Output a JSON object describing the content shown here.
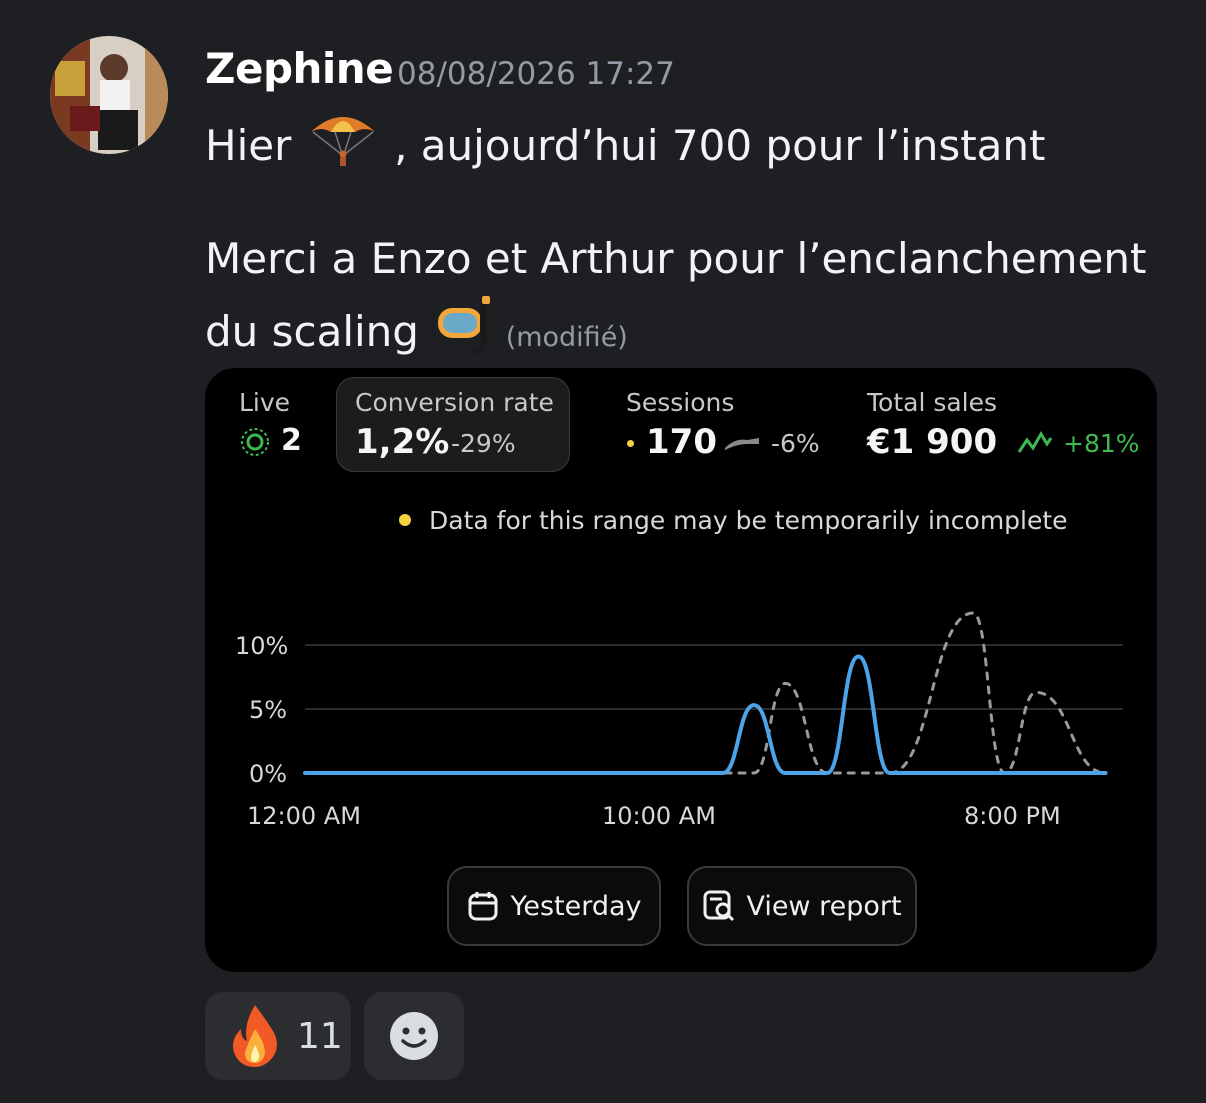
{
  "message": {
    "author": "Zephine",
    "timestamp": "08/08/2026 17:27",
    "line1_before": "Hier",
    "line1_after": ", aujourd’hui 700 pour l’instant",
    "line2": "Merci a Enzo et Arthur pour l’enclanchement",
    "line3": "du scaling",
    "edited_label": "(modifié)",
    "icons": [
      "parachute-emoji",
      "diving-mask-emoji"
    ]
  },
  "embed": {
    "live": {
      "label": "Live",
      "value": "2"
    },
    "conversion": {
      "label": "Conversion rate",
      "value": "1,2%",
      "delta": "-29%"
    },
    "sessions": {
      "label": "Sessions",
      "value": "170",
      "delta": "-6%"
    },
    "sales": {
      "label": "Total sales",
      "value": "€1 900",
      "delta": "+81%"
    },
    "notice": "Data for this range may be temporarily incomplete",
    "buttons": {
      "yesterday": "Yesterday",
      "report": "View report"
    },
    "colors": {
      "accent": "#4da3e8",
      "positive": "#3fb950",
      "notice_dot": "#f5d142"
    }
  },
  "chart_data": {
    "type": "line",
    "y_ticks": [
      "10%",
      "5%",
      "0%"
    ],
    "x_ticks": [
      "12:00 AM",
      "10:00 AM",
      "8:00 PM"
    ],
    "ylim": [
      0,
      10
    ],
    "x": [
      0,
      12,
      12.9,
      13.8,
      15,
      15.9,
      16.8,
      19.2,
      20.1,
      21,
      23
    ],
    "series": [
      {
        "style": "solid",
        "color": "#4da3e8",
        "values": [
          0,
          0,
          5.3,
          0,
          0,
          9.1,
          0,
          0,
          0,
          0,
          0
        ]
      },
      {
        "style": "dashed",
        "color": "#9a9a9a",
        "values": [
          0,
          0,
          0,
          7,
          0,
          0,
          0,
          12.5,
          0,
          6.3,
          0
        ]
      }
    ],
    "grid": true
  },
  "reactions": [
    {
      "icon": "fire-emoji",
      "count": "11"
    },
    {
      "icon": "add-reaction-smiley-icon"
    }
  ]
}
